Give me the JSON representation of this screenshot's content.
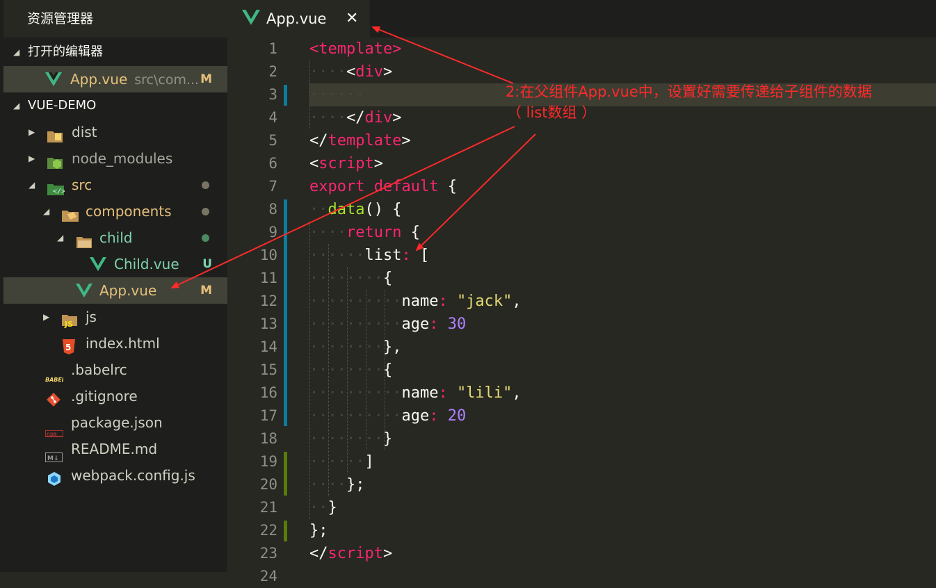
{
  "sidebar": {
    "title": "资源管理器",
    "open_editors": {
      "header": "打开的编辑器",
      "items": [
        {
          "name": "App.vue",
          "path": "src\\com...",
          "badge": "M",
          "icon": "vue-icon"
        }
      ]
    },
    "project": {
      "header": "VUE-DEMO",
      "items": [
        {
          "name": "dist",
          "icon": "folder-dist-icon"
        },
        {
          "name": "node_modules",
          "icon": "folder-node-icon"
        },
        {
          "name": "src",
          "icon": "folder-src-icon"
        },
        {
          "name": "components",
          "icon": "folder-components-icon"
        },
        {
          "name": "child",
          "icon": "folder-icon"
        },
        {
          "name": "Child.vue",
          "badge": "U",
          "icon": "vue-icon"
        },
        {
          "name": "App.vue",
          "badge": "M",
          "icon": "vue-icon"
        },
        {
          "name": "js",
          "icon": "folder-js-icon"
        },
        {
          "name": "index.html",
          "icon": "html5-icon"
        },
        {
          "name": ".babelrc",
          "icon": "babel-icon"
        },
        {
          "name": ".gitignore",
          "icon": "git-icon"
        },
        {
          "name": "package.json",
          "icon": "npm-icon"
        },
        {
          "name": "README.md",
          "icon": "markdown-icon"
        },
        {
          "name": "webpack.config.js",
          "icon": "webpack-icon"
        }
      ]
    }
  },
  "tab": {
    "name": "App.vue",
    "close": "✕"
  },
  "editor": {
    "line_numbers": [
      "1",
      "2",
      "3",
      "4",
      "5",
      "6",
      "7",
      "8",
      "9",
      "10",
      "11",
      "12",
      "13",
      "14",
      "15",
      "16",
      "17",
      "18",
      "19",
      "20",
      "21",
      "22",
      "23",
      "24"
    ]
  },
  "annotation": {
    "line1": "2:在父组件App.vue中，设置好需要传递给子组件的数据",
    "line2": "（ list数组 ）",
    "color": "#ff2a2a"
  },
  "colors": {
    "background": "#272822",
    "sidebar": "#1e1f1c",
    "selection": "#414339",
    "keyword": "#f92672",
    "function": "#a6e22e",
    "string": "#e6db74",
    "number": "#ae81ff"
  }
}
